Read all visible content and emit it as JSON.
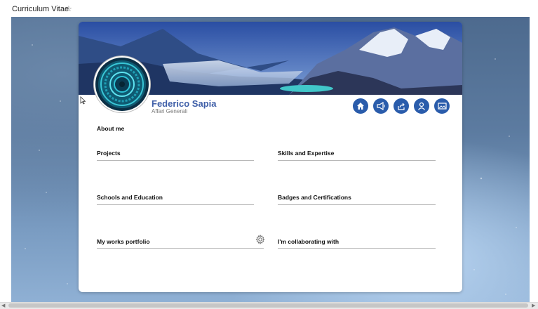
{
  "page": {
    "title": "Curriculum Vitae",
    "favorite_icon": "star-outline-icon"
  },
  "profile": {
    "name": "Federico Sapia",
    "role": "Affari Generali",
    "avatar_icon": "circular-pattern-avatar",
    "banner": "mountain-landscape-banner"
  },
  "actions": [
    {
      "icon": "home-icon"
    },
    {
      "icon": "megaphone-icon"
    },
    {
      "icon": "share-icon"
    },
    {
      "icon": "person-icon"
    },
    {
      "icon": "image-icon"
    }
  ],
  "sections": {
    "about": "About me",
    "projects": "Projects",
    "skills": "Skills and Expertise",
    "schools": "Schools and Education",
    "badges": "Badges and Certifications",
    "portfolio": "My works portfolio",
    "collaborating": "I'm collaborating with"
  },
  "colors": {
    "accent": "#2a5cab",
    "name": "#3f5fa8"
  }
}
